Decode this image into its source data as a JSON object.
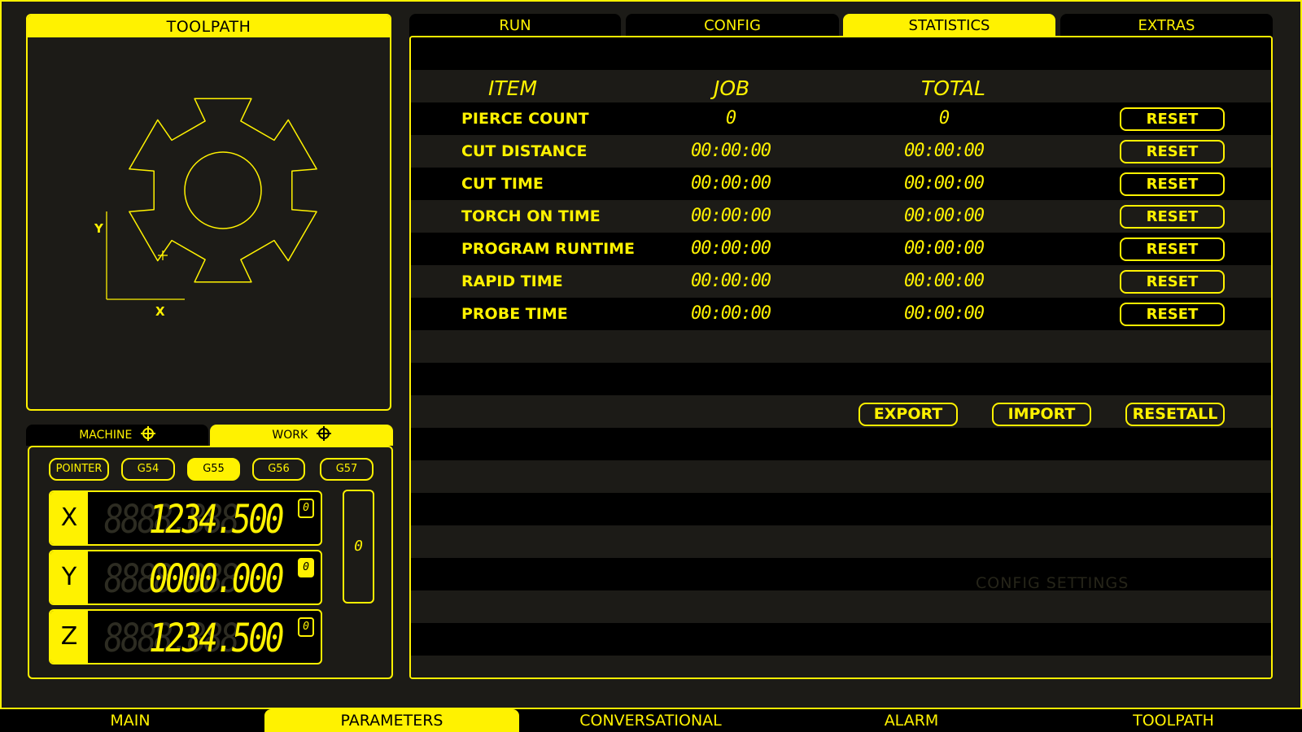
{
  "colors": {
    "accent": "#FFF200",
    "panel": "#1c1b17",
    "background": "#000000"
  },
  "toolpath": {
    "title": "TOOLPATH",
    "axis_y": "Y",
    "axis_x": "X",
    "icon": "gear-outline"
  },
  "dro": {
    "tabs": {
      "machine": "MACHINE",
      "work": "WORK"
    },
    "coord_systems": [
      "POINTER",
      "G54",
      "G55",
      "G56",
      "G57"
    ],
    "active_coord_system": "G55",
    "axes": [
      {
        "letter": "X",
        "value": "1234.500",
        "ghost": "8888.888",
        "mini": "0"
      },
      {
        "letter": "Y",
        "value": "0000.000",
        "ghost": "8888.888",
        "mini": "0"
      },
      {
        "letter": "Z",
        "value": "1234.500",
        "ghost": "8888.888",
        "mini": "0"
      }
    ],
    "side_value": "0"
  },
  "top_tabs": [
    "RUN",
    "CONFIG",
    "STATISTICS",
    "EXTRAS"
  ],
  "active_top_tab": "STATISTICS",
  "statistics": {
    "headers": {
      "item": "ITEM",
      "job": "JOB",
      "total": "TOTAL"
    },
    "rows": [
      {
        "item": "PIERCE COUNT",
        "job": "0",
        "total": "0",
        "reset": "RESET"
      },
      {
        "item": "CUT DISTANCE",
        "job": "00:00:00",
        "total": "00:00:00",
        "reset": "RESET"
      },
      {
        "item": "CUT TIME",
        "job": "00:00:00",
        "total": "00:00:00",
        "reset": "RESET"
      },
      {
        "item": "TORCH ON TIME",
        "job": "00:00:00",
        "total": "00:00:00",
        "reset": "RESET"
      },
      {
        "item": "PROGRAM RUNTIME",
        "job": "00:00:00",
        "total": "00:00:00",
        "reset": "RESET"
      },
      {
        "item": "RAPID TIME",
        "job": "00:00:00",
        "total": "00:00:00",
        "reset": "RESET"
      },
      {
        "item": "PROBE TIME",
        "job": "00:00:00",
        "total": "00:00:00",
        "reset": "RESET"
      }
    ],
    "actions": {
      "export": "EXPORT",
      "import": "IMPORT",
      "resetall": "RESETALL"
    },
    "faint_label": "CONFIG  SETTINGS"
  },
  "bottom_nav": [
    "MAIN",
    "PARAMETERS",
    "CONVERSATIONAL",
    "ALARM",
    "TOOLPATH"
  ],
  "active_bottom_tab": "PARAMETERS"
}
